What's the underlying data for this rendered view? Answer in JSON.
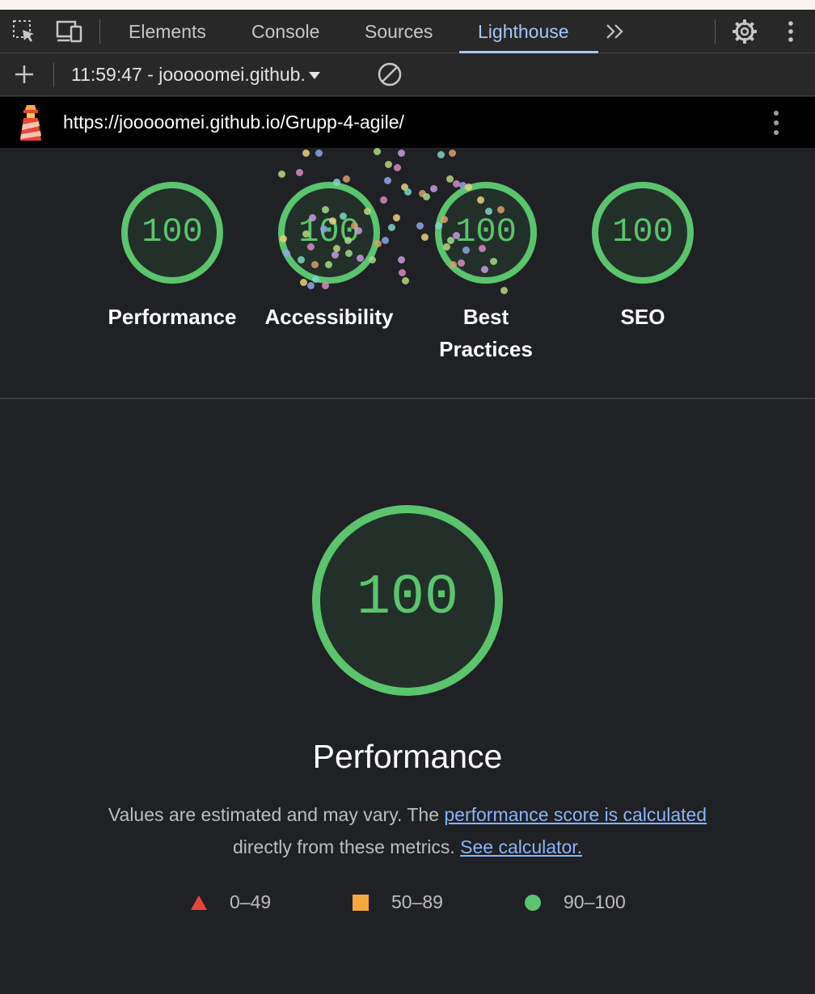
{
  "devtools": {
    "tabs": [
      {
        "label": "Elements"
      },
      {
        "label": "Console"
      },
      {
        "label": "Sources"
      },
      {
        "label": "Lighthouse"
      }
    ],
    "more_tabs_icon": "chevron-double-right-icon",
    "settings_icon": "gear-icon",
    "menu_icon": "kebab-icon"
  },
  "report_bar": {
    "report_select": "11:59:47 - jooooomei.github.",
    "new_report_icon": "plus-icon",
    "clear_icon": "block-icon"
  },
  "url_bar": {
    "url": "https://jooooomei.github.io/Grupp-4-agile/",
    "logo_icon": "lighthouse-icon"
  },
  "categories": [
    {
      "score": "100",
      "label_line1": "Performance",
      "label_line2": ""
    },
    {
      "score": "100",
      "label_line1": "Accessibility",
      "label_line2": ""
    },
    {
      "score": "100",
      "label_line1": "Best",
      "label_line2": "Practices"
    },
    {
      "score": "100",
      "label_line1": "SEO",
      "label_line2": ""
    }
  ],
  "main_gauge": {
    "score": "100",
    "title": "Performance"
  },
  "description": {
    "text1": "Values are estimated and may vary. The ",
    "link1": "performance score is calculated",
    "text2": "directly from these metrics. ",
    "link2": "See calculator."
  },
  "legend": [
    {
      "icon": "triangle-icon",
      "range": "0–49",
      "color": "#e8453c"
    },
    {
      "icon": "square-icon",
      "range": "50–89",
      "color": "#f4a93c"
    },
    {
      "icon": "circle-icon",
      "range": "90–100",
      "color": "#5bc46e"
    }
  ],
  "colors": {
    "pass": "#5bc46e",
    "accent": "#a8c7fa",
    "link": "#8ab4f8"
  }
}
